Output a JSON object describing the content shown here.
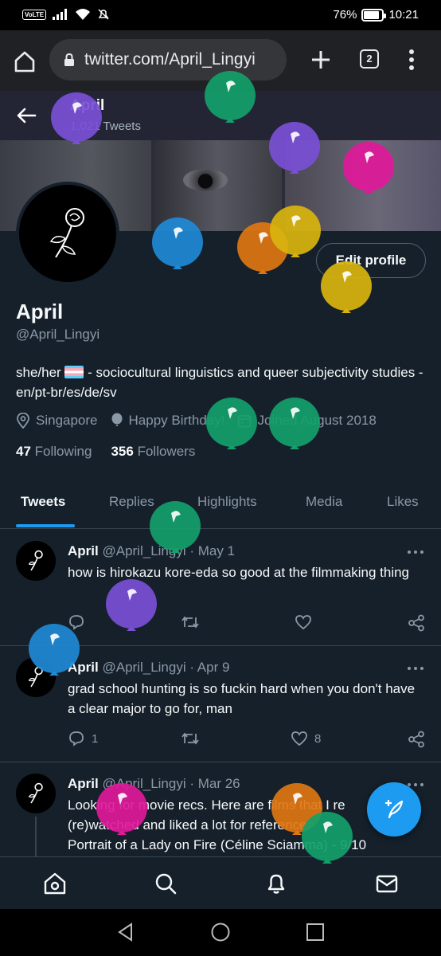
{
  "status_bar": {
    "network": "VoLTE",
    "battery_percent": "76%",
    "battery_level": 0.76,
    "time": "10:21"
  },
  "browser": {
    "url": "twitter.com/April_Lingyi",
    "tab_count": "2"
  },
  "header": {
    "name": "April",
    "tweet_count": "1,021 Tweets"
  },
  "profile": {
    "display_name": "April",
    "handle": "@April_Lingyi",
    "edit_label": "Edit profile",
    "bio_pre": "she/her",
    "bio_post": "- sociocultural linguistics and queer subjectivity studies - en/pt-br/es/de/sv",
    "location": "Singapore",
    "birthday": "Happy Birthday!",
    "joined": "Joined August 2018",
    "following_count": "47",
    "following_label": "Following",
    "followers_count": "356",
    "followers_label": "Followers"
  },
  "tabs": [
    "Tweets",
    "Replies",
    "Highlights",
    "Media",
    "Likes"
  ],
  "tweets": [
    {
      "name": "April",
      "meta": "@April_Lingyi · May 1",
      "text": "how is hirokazu kore-eda so good at the filmmaking thing",
      "replies": "",
      "likes": ""
    },
    {
      "name": "April",
      "meta": "@April_Lingyi · Apr 9",
      "text": "grad school hunting is so fuckin hard when you don't have a clear major to go for, man",
      "replies": "1",
      "likes": "8"
    },
    {
      "name": "April",
      "meta": "@April_Lingyi · Mar 26",
      "text_lines": [
        "Looking for movie recs. Here are films that I re",
        "(re)watched and liked a lot for reference:",
        "Portrait of a Lady on Fire (Céline Sciamma) - 9/10"
      ]
    }
  ],
  "colors": {
    "background": "#15202b",
    "accent": "#1d9bf0",
    "balloons": [
      "#7a4fd6",
      "#e0199a",
      "#1f8ad6",
      "#e07612",
      "#d9b40e",
      "#14a06a"
    ]
  },
  "icons": {
    "nav": [
      "home-icon",
      "search-icon",
      "bell-icon",
      "mail-icon"
    ],
    "fab": "compose-icon"
  }
}
